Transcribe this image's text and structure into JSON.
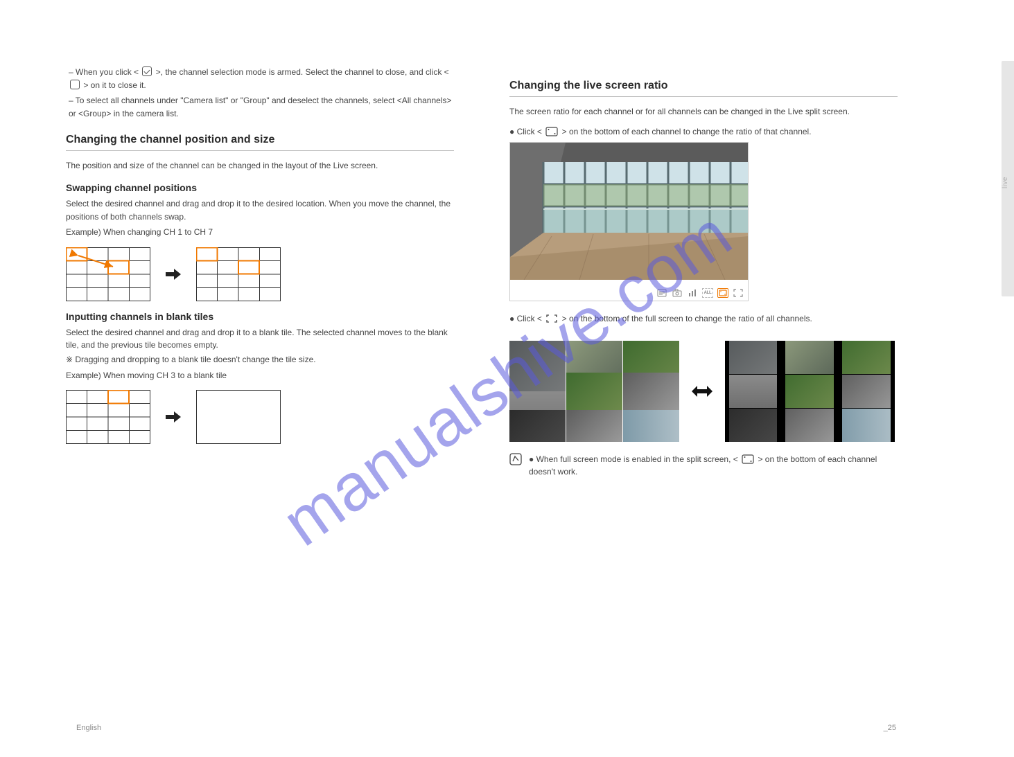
{
  "sideTab": "live",
  "left": {
    "pre": {
      "line1a": "When you click <",
      "line1b": ">, the channel selection mode is armed. Select the channel to close, and click <",
      "line1c": "> on it to close it.",
      "line2": "To select all channels under \"Camera list\" or \"Group\" and deselect the channels, select <All channels> or <Group> in the camera list."
    },
    "section1": {
      "title": "Changing the channel position and size",
      "desc": "The position and size of the channel can be changed in the layout of the Live screen."
    },
    "sub1": {
      "title": "Swapping channel positions",
      "desc": "Select the desired channel and drag and drop it to the desired location. When you move the channel, the positions of both channels swap.",
      "example": "Example) When changing CH 1 to CH 7"
    },
    "sub2": {
      "title": "Inputting channels in blank tiles",
      "desc": "Select the desired channel and drag and drop it to a blank tile. The selected channel moves to the blank tile, and the previous tile becomes empty.",
      "note": "Dragging and dropping to a blank tile doesn't change the tile size.",
      "example": "Example) When moving CH 3 to a blank tile"
    }
  },
  "right": {
    "section": {
      "title": "Changing the live screen ratio",
      "lead": "The screen ratio for each channel or for all channels can be changed in the Live split screen.",
      "singleA": "Click <",
      "singleB": "> on the bottom of each channel to change the ratio of that channel.",
      "multiA": "Click <",
      "multiB": "> on the bottom of the full screen to change the ratio of all channels.",
      "noteA": "When full screen mode is enabled in the split screen, <",
      "noteB": "> on the bottom of each channel doesn't work."
    },
    "toolbar": {
      "i1": "info-icon",
      "i2": "capture-icon",
      "i3": "stats-icon",
      "i4": "all-icon",
      "i5": "ratio-icon",
      "i6": "fullscreen-icon",
      "allLabel": "ALL"
    }
  },
  "footer": {
    "left": "English",
    "right": "_25"
  },
  "watermark": "manualshive.com"
}
